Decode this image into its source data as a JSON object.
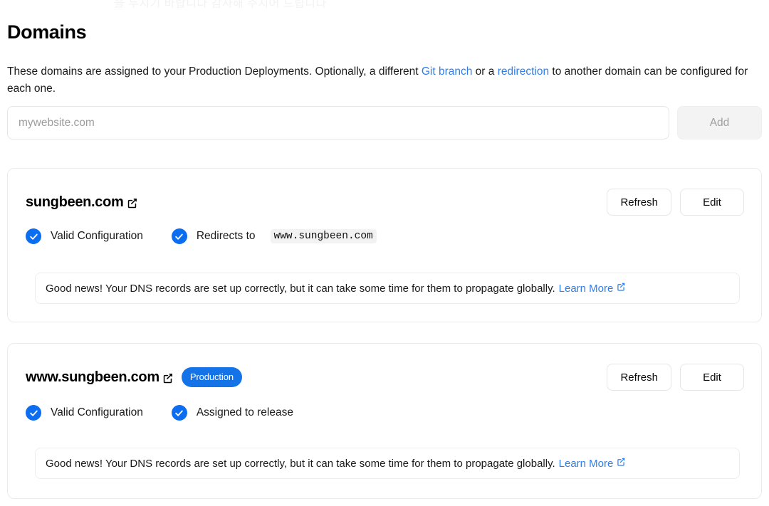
{
  "ghost_text": "을 두시기 바랍니다 감사해 주시어 드립니다",
  "header": {
    "title": "Domains",
    "description_part1": "These domains are assigned to your Production Deployments. Optionally, a different ",
    "description_link1": "Git branch",
    "description_part2": " or a ",
    "description_link2": "redirection",
    "description_part3": " to another domain can be configured for each one."
  },
  "add_form": {
    "input_placeholder": "mywebsite.com",
    "input_value": "",
    "add_label": "Add"
  },
  "domains": [
    {
      "name": "sungbeen.com",
      "external_icon": "external-link-icon",
      "badge": null,
      "refresh_label": "Refresh",
      "edit_label": "Edit",
      "statuses": [
        {
          "icon": "check-circle-icon",
          "label": "Valid Configuration",
          "code": null
        },
        {
          "icon": "check-circle-icon",
          "label": "Redirects to",
          "code": "www.sungbeen.com"
        }
      ],
      "notice_text": "Good news! Your DNS records are set up correctly, but it can take some time for them to propagate globally.",
      "notice_link": "Learn More"
    },
    {
      "name": "www.sungbeen.com",
      "external_icon": "external-link-icon",
      "badge": "Production",
      "refresh_label": "Refresh",
      "edit_label": "Edit",
      "statuses": [
        {
          "icon": "check-circle-icon",
          "label": "Valid Configuration",
          "code": null
        },
        {
          "icon": "check-circle-icon",
          "label": "Assigned to release",
          "code": null
        }
      ],
      "notice_text": "Good news! Your DNS records are set up correctly, but it can take some time for them to propagate globally.",
      "notice_link": "Learn More"
    }
  ],
  "colors": {
    "accent_blue": "#0b6ef0",
    "badge_blue": "#1473e6",
    "link_blue": "#2f7eea",
    "border": "#ebebeb",
    "disabled_bg": "#f3f3f3"
  }
}
